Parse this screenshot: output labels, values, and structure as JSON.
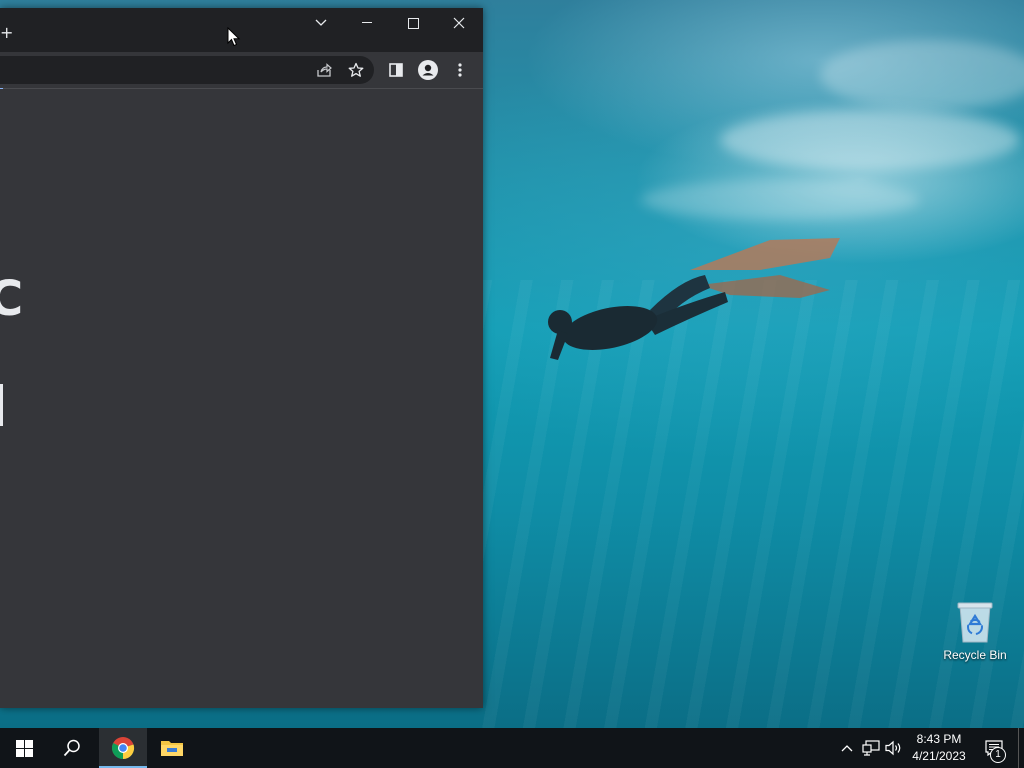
{
  "desktop": {
    "wallpaper": "underwater freediver with fins",
    "icons": [
      {
        "label": "Recycle Bin",
        "icon": "recycle-bin-icon"
      }
    ]
  },
  "browser": {
    "app": "Google Chrome",
    "theme": "dark",
    "title_bar": {
      "tab_search_icon": "chevron-down-icon",
      "minimize_icon": "minimize-icon",
      "maximize_icon": "maximize-icon",
      "close_icon": "close-icon"
    },
    "toolbar": {
      "share_icon": "share-icon",
      "bookmark_icon": "star-icon",
      "side_panel_icon": "side-panel-icon",
      "profile_icon": "profile-icon",
      "menu_icon": "kebab-menu-icon"
    },
    "colors": {
      "titlebar": "#202124",
      "toolbar": "#35363a",
      "content": "#35363a",
      "icon": "#e8eaed"
    }
  },
  "taskbar": {
    "start_icon": "windows-start-icon",
    "search_icon": "search-icon",
    "pinned": [
      {
        "name": "Google Chrome",
        "icon": "chrome-icon",
        "active": true
      },
      {
        "name": "File Explorer",
        "icon": "file-explorer-icon",
        "active": false
      }
    ],
    "tray": {
      "icons": [
        "chevron-up-icon",
        "network-icon",
        "volume-icon"
      ],
      "time": "8:43 PM",
      "date": "4/21/2023",
      "notification_count": "1"
    },
    "colors": {
      "background": "#101418",
      "active_indicator": "#76b9ed"
    }
  }
}
